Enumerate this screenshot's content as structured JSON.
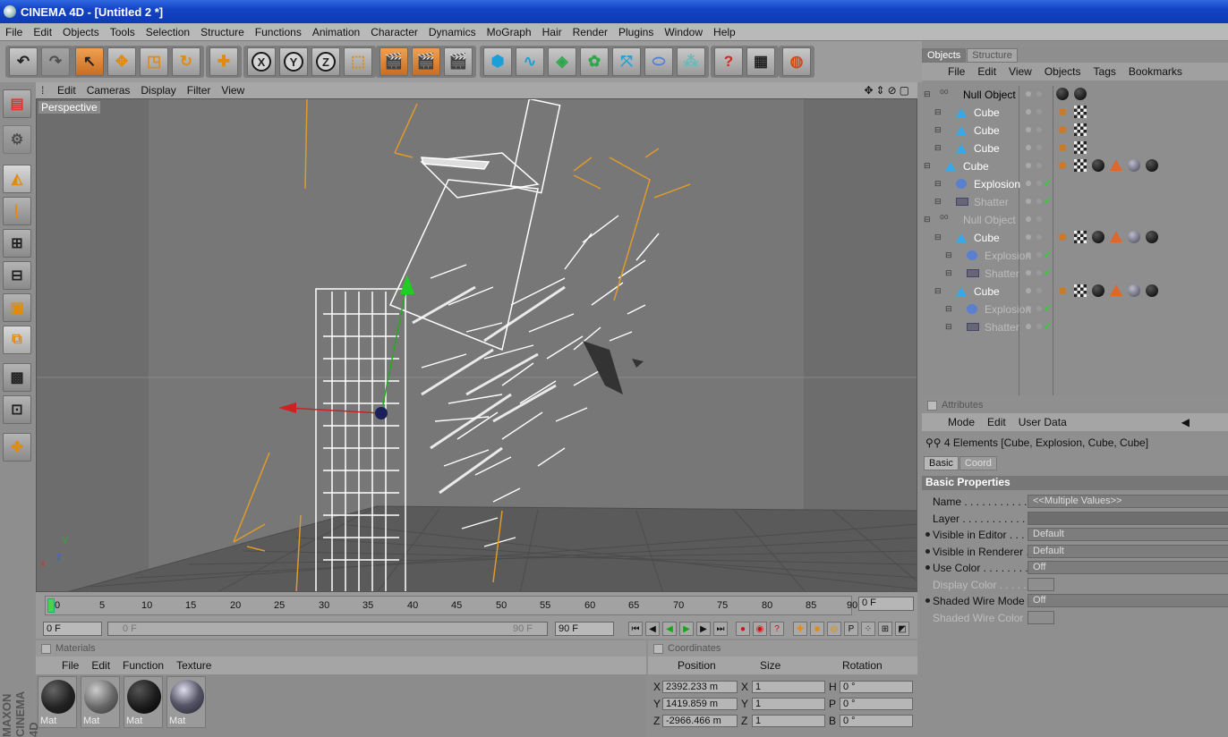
{
  "window": {
    "title": "CINEMA 4D - [Untitled 2 *]"
  },
  "menu": [
    "File",
    "Edit",
    "Objects",
    "Tools",
    "Selection",
    "Structure",
    "Functions",
    "Animation",
    "Character",
    "Dynamics",
    "MoGraph",
    "Hair",
    "Render",
    "Plugins",
    "Window",
    "Help"
  ],
  "toolbar": {
    "axis_x": "X",
    "axis_y": "Y",
    "axis_z": "Z",
    "help": "?"
  },
  "viewport": {
    "menu": [
      "Edit",
      "Cameras",
      "Display",
      "Filter",
      "View"
    ],
    "label": "Perspective"
  },
  "timeline": {
    "ticks": [
      "0",
      "5",
      "10",
      "15",
      "20",
      "25",
      "30",
      "35",
      "40",
      "45",
      "50",
      "55",
      "60",
      "65",
      "70",
      "75",
      "80",
      "85",
      "90"
    ],
    "current_frame": "0 F",
    "start_frame": "0 F",
    "range_start": "0 F",
    "range_end": "90 F",
    "end_frame": "90 F"
  },
  "materials": {
    "header": "Materials",
    "menu": [
      "File",
      "Edit",
      "Function",
      "Texture"
    ],
    "items": [
      {
        "label": "Mat"
      },
      {
        "label": "Mat"
      },
      {
        "label": "Mat"
      },
      {
        "label": "Mat"
      }
    ]
  },
  "coordinates": {
    "header": "Coordinates",
    "columns": [
      "Position",
      "Size",
      "Rotation"
    ],
    "pos_x": "2392.233 m",
    "pos_y": "1419.859 m",
    "pos_z": "-2966.466 m",
    "size_x": "1",
    "size_y": "1",
    "size_z": "1",
    "rot_h": "0 °",
    "rot_p": "0 °",
    "rot_b": "0 °",
    "label_x": "X",
    "label_y": "Y",
    "label_z": "Z",
    "label_h": "H",
    "label_p": "P",
    "label_b": "B"
  },
  "objects": {
    "tabs": [
      "Objects",
      "Structure"
    ],
    "menu": [
      "File",
      "Edit",
      "View",
      "Objects",
      "Tags",
      "Bookmarks"
    ],
    "rows": [
      {
        "name": "Null Object",
        "indent": 0,
        "icon": "null",
        "dim": false
      },
      {
        "name": "Cube",
        "indent": 1,
        "icon": "cube",
        "dim": false
      },
      {
        "name": "Cube",
        "indent": 1,
        "icon": "cube",
        "dim": false
      },
      {
        "name": "Cube",
        "indent": 1,
        "icon": "cube",
        "dim": false
      },
      {
        "name": "Cube",
        "indent": 0,
        "icon": "cube",
        "dim": false
      },
      {
        "name": "Explosion",
        "indent": 1,
        "icon": "explosion",
        "dim": false
      },
      {
        "name": "Shatter",
        "indent": 1,
        "icon": "shatter",
        "dim": true
      },
      {
        "name": "Null Object",
        "indent": 0,
        "icon": "null",
        "dim": true
      },
      {
        "name": "Cube",
        "indent": 1,
        "icon": "cube",
        "dim": false
      },
      {
        "name": "Explosion",
        "indent": 2,
        "icon": "explosion",
        "dim": true
      },
      {
        "name": "Shatter",
        "indent": 2,
        "icon": "shatter",
        "dim": true
      },
      {
        "name": "Cube",
        "indent": 1,
        "icon": "cube",
        "dim": false
      },
      {
        "name": "Explosion",
        "indent": 2,
        "icon": "explosion",
        "dim": true
      },
      {
        "name": "Shatter",
        "indent": 2,
        "icon": "shatter",
        "dim": true
      }
    ]
  },
  "attributes": {
    "header": "Attributes",
    "menu": [
      "Mode",
      "Edit",
      "User Data"
    ],
    "selection": "4 Elements [Cube, Explosion, Cube, Cube]",
    "tabs": [
      "Basic",
      "Coord"
    ],
    "section": "Basic Properties",
    "rows": [
      {
        "label": "Name . . . . . . . . . . . .",
        "value": "<<Multiple Values>>"
      },
      {
        "label": "Layer . . . . . . . . . . . .",
        "value": ""
      },
      {
        "label": "Visible in Editor . . . . .",
        "value": "Default"
      },
      {
        "label": "Visible in Renderer . . .",
        "value": "Default"
      },
      {
        "label": "Use Color . . . . . . . . .",
        "value": "Off"
      },
      {
        "label": "Display Color . . . . . . .",
        "value": ""
      },
      {
        "label": "Shaded Wire Mode",
        "value": "Off"
      },
      {
        "label": "Shaded Wire Color",
        "value": ""
      }
    ]
  },
  "corner": "MAXON CINEMA 4D"
}
